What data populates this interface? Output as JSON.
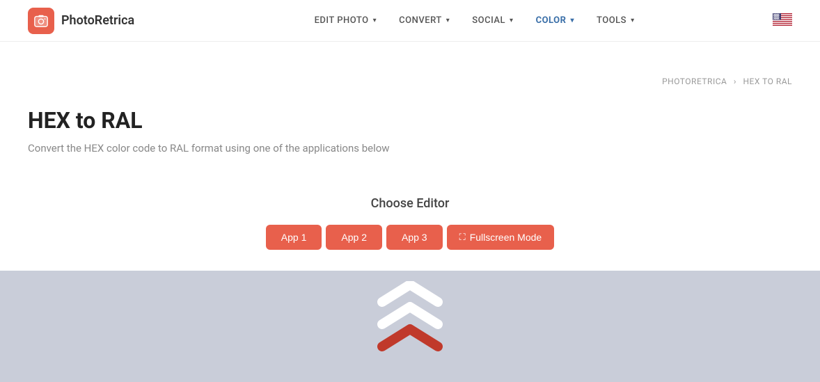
{
  "header": {
    "logo_text": "PhotoRetrica",
    "nav_items": [
      {
        "label": "EDIT PHOTO",
        "key": "edit-photo",
        "active": false
      },
      {
        "label": "CONVERT",
        "key": "convert",
        "active": false
      },
      {
        "label": "SOCIAL",
        "key": "social",
        "active": false
      },
      {
        "label": "COLOR",
        "key": "color",
        "active": true
      },
      {
        "label": "TOOLS",
        "key": "tools",
        "active": false
      }
    ]
  },
  "breadcrumb": {
    "home": "PHOTORETRICA",
    "separator": "›",
    "current": "HEX TO RAL"
  },
  "page": {
    "title": "HEX to RAL",
    "subtitle": "Convert the HEX color code to RAL format using one of the applications below"
  },
  "editor": {
    "title": "Choose Editor",
    "buttons": [
      {
        "label": "App 1",
        "key": "app1"
      },
      {
        "label": "App 2",
        "key": "app2"
      },
      {
        "label": "App 3",
        "key": "app3"
      }
    ],
    "fullscreen_label": "Fullscreen Mode"
  },
  "colors": {
    "brand": "#e8604c",
    "nav_active": "#3a6fa8",
    "preview_bg": "#c9cdd9"
  }
}
